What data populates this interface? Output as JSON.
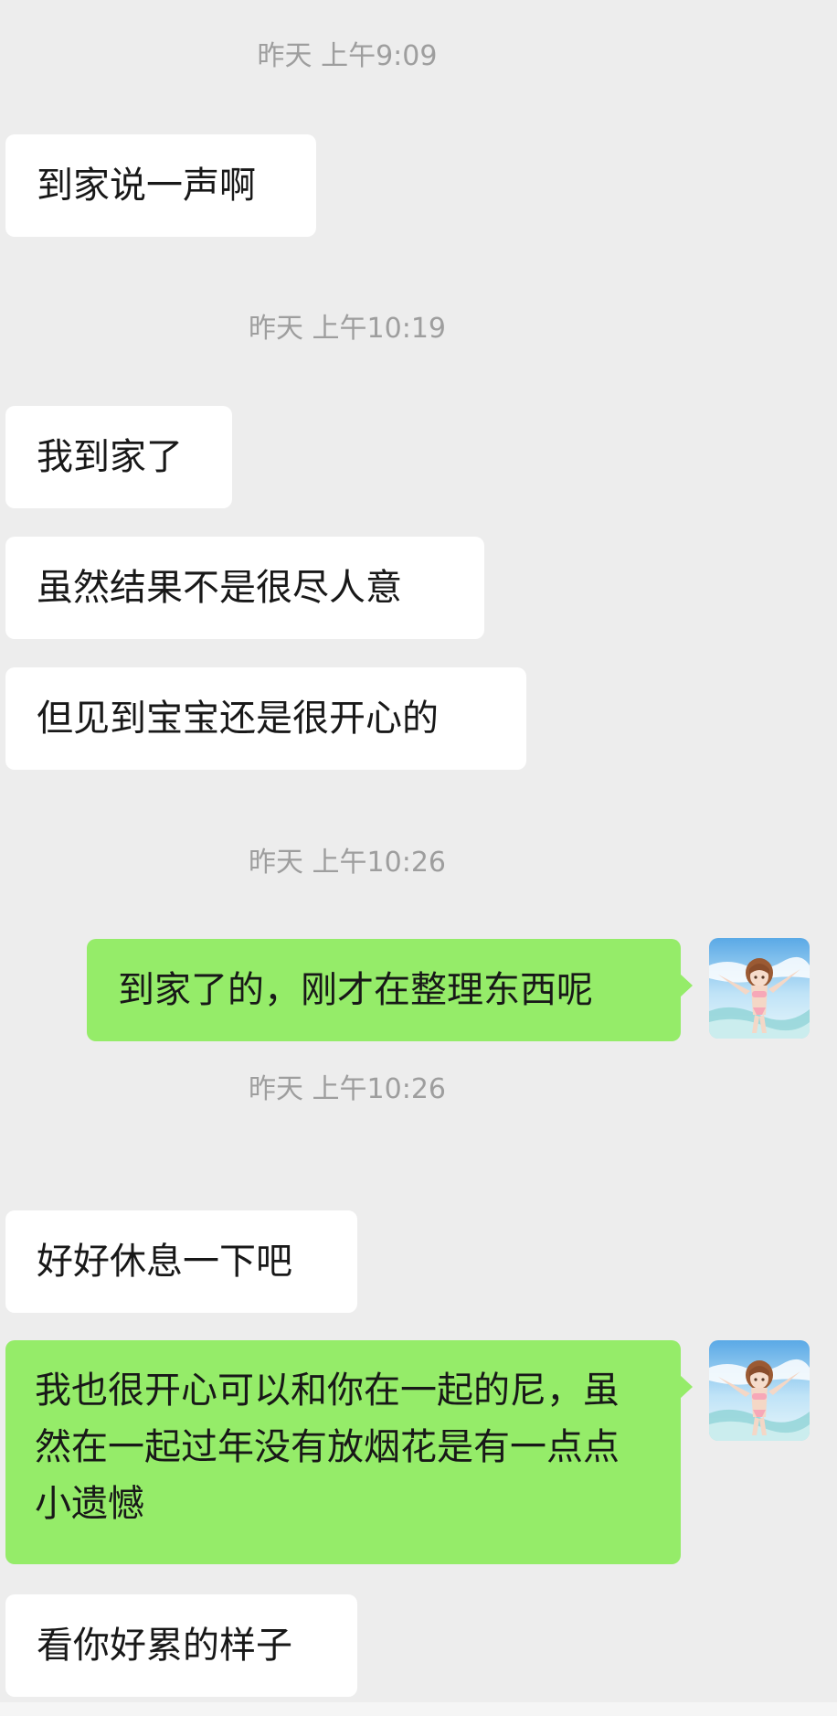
{
  "messages": [
    {
      "type": "timestamp",
      "text": "昨天 上午9:09"
    },
    {
      "type": "received",
      "text": "到家说一声啊"
    },
    {
      "type": "timestamp",
      "text": "昨天 上午10:19"
    },
    {
      "type": "received",
      "text": "我到家了"
    },
    {
      "type": "received",
      "text": "虽然结果不是很尽人意"
    },
    {
      "type": "received",
      "text": "但见到宝宝还是很开心的"
    },
    {
      "type": "timestamp",
      "text": "昨天 上午10:26"
    },
    {
      "type": "sent",
      "text": "到家了的，刚才在整理东西呢",
      "avatar": "anime-girl-beach-avatar"
    },
    {
      "type": "timestamp",
      "text": "昨天 上午10:26"
    },
    {
      "type": "received",
      "text": "好好休息一下吧"
    },
    {
      "type": "sent",
      "text": "我也很开心可以和你在一起的尼，虽然在一起过年没有放烟花是有一点点小遗憾",
      "avatar": "anime-girl-beach-avatar"
    },
    {
      "type": "received",
      "text": "看你好累的样子"
    }
  ],
  "colors": {
    "background": "#ededed",
    "received_bubble": "#ffffff",
    "sent_bubble": "#95ec69",
    "timestamp_text": "#9e9e9e",
    "message_text": "#181818"
  }
}
